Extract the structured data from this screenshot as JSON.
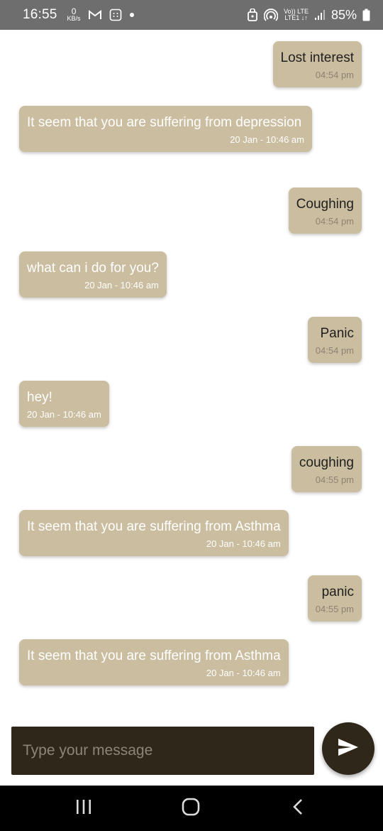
{
  "status_bar": {
    "time": "16:55",
    "net_speed_value": "0",
    "net_speed_unit": "KB/s",
    "volte_top": "Vo)) LTE",
    "volte_bottom": "LTE1 ↓↑",
    "battery": "85%"
  },
  "messages": [
    {
      "sender": "user",
      "text": "Lost interest",
      "time": "04:54 pm"
    },
    {
      "sender": "bot",
      "text": "It seem that you are suffering from depression",
      "time": "20 Jan - 10:46 am"
    },
    {
      "sender": "user",
      "text": "Coughing",
      "time": "04:54 pm"
    },
    {
      "sender": "bot",
      "text": "what can i do for you?",
      "time": "20 Jan - 10:46 am"
    },
    {
      "sender": "user",
      "text": "Panic",
      "time": "04:54 pm"
    },
    {
      "sender": "bot",
      "text": "hey!",
      "time": "20 Jan - 10:46 am"
    },
    {
      "sender": "user",
      "text": "coughing",
      "time": "04:55 pm"
    },
    {
      "sender": "bot",
      "text": "It seem that you are suffering from Asthma",
      "time": "20 Jan - 10:46 am"
    },
    {
      "sender": "user",
      "text": "panic",
      "time": "04:55 pm"
    },
    {
      "sender": "bot",
      "text": "It seem that you are suffering from Asthma",
      "time": "20 Jan - 10:46 am"
    }
  ],
  "composer": {
    "placeholder": "Type your message",
    "value": ""
  },
  "icons": {
    "send": "send-icon",
    "recents": "recent-apps-icon",
    "home": "home-icon",
    "back": "back-icon"
  },
  "colors": {
    "bubble": "#cbbd9f",
    "input_bg": "#30271b",
    "status_bar": "#6e6e6e",
    "nav_bar": "#000000"
  }
}
